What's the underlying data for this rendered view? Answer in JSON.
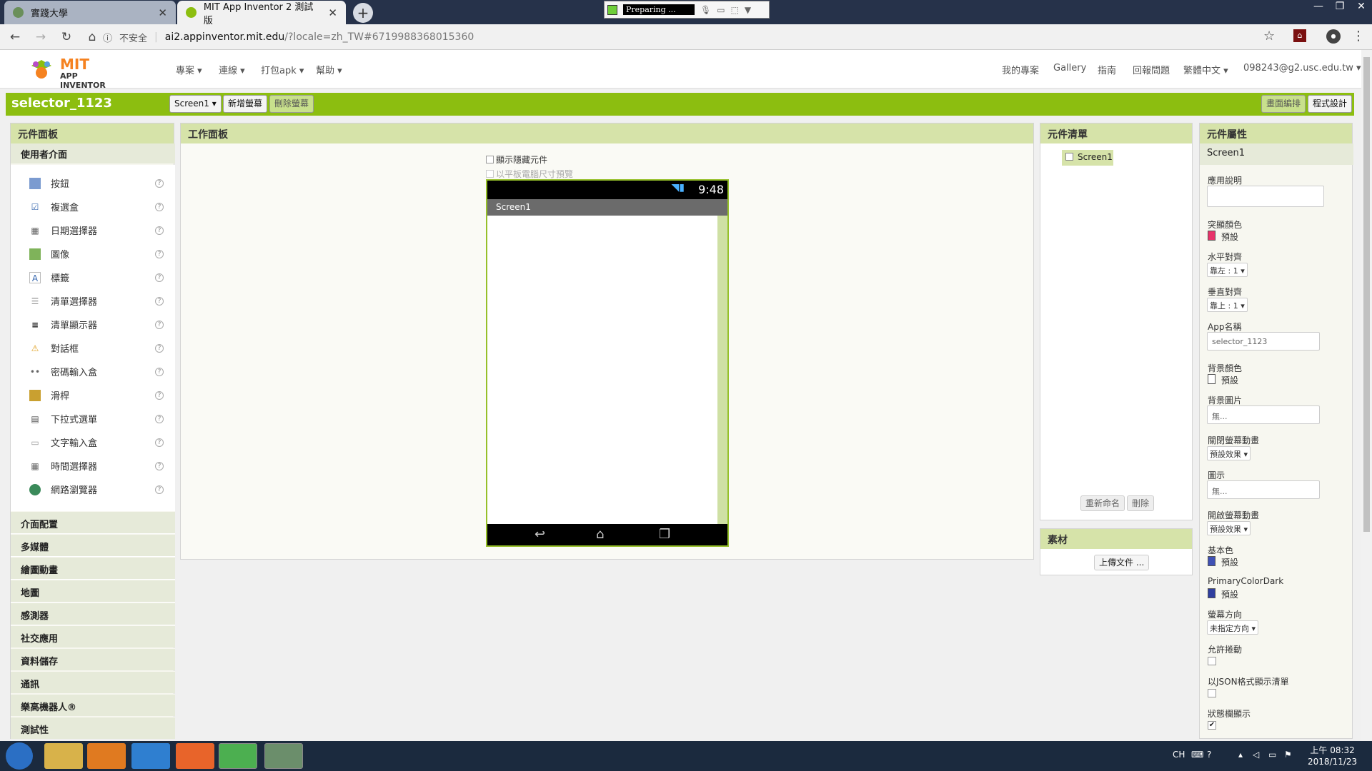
{
  "browser": {
    "tabs": [
      {
        "label": "實踐大學"
      },
      {
        "label": "MIT App Inventor 2 測試版"
      }
    ],
    "recorder": {
      "status": "Preparing ..."
    },
    "security_label": "不安全",
    "url_host": "ai2.appinventor.mit.edu",
    "url_path": "/?locale=zh_TW#6719988368015360"
  },
  "topnav": {
    "logo_mit": "MIT",
    "logo_sub": "APP INVENTOR",
    "menus": [
      "專案 ▾",
      "連線 ▾",
      "打包apk ▾",
      "幫助 ▾"
    ],
    "right_links": [
      "我的專案",
      "Gallery",
      "指南",
      "回報問題",
      "繁體中文 ▾",
      "098243@g2.usc.edu.tw ▾"
    ]
  },
  "project": {
    "name": "selector_1123",
    "screen_select": "Screen1 ▾",
    "add_screen": "新增螢幕",
    "remove_screen": "刪除螢幕",
    "designer": "畫面編排",
    "blocks": "程式設計"
  },
  "palette": {
    "title": "元件面板",
    "open_category": "使用者介面",
    "items": [
      {
        "label": "按鈕",
        "icon": "button-icon"
      },
      {
        "label": "複選盒",
        "icon": "checkbox-icon"
      },
      {
        "label": "日期選擇器",
        "icon": "datepicker-icon"
      },
      {
        "label": "圖像",
        "icon": "image-icon"
      },
      {
        "label": "標籤",
        "icon": "label-icon"
      },
      {
        "label": "清單選擇器",
        "icon": "listpicker-icon"
      },
      {
        "label": "清單顯示器",
        "icon": "listview-icon"
      },
      {
        "label": "對話框",
        "icon": "notifier-icon"
      },
      {
        "label": "密碼輸入盒",
        "icon": "password-icon"
      },
      {
        "label": "滑桿",
        "icon": "slider-icon"
      },
      {
        "label": "下拉式選單",
        "icon": "spinner-icon"
      },
      {
        "label": "文字輸入盒",
        "icon": "textbox-icon"
      },
      {
        "label": "時間選擇器",
        "icon": "timepicker-icon"
      },
      {
        "label": "網路瀏覽器",
        "icon": "webviewer-icon"
      }
    ],
    "categories": [
      "介面配置",
      "多媒體",
      "繪圖動畫",
      "地圖",
      "感測器",
      "社交應用",
      "資料儲存",
      "通訊",
      "樂高機器人®",
      "測試性"
    ]
  },
  "viewer": {
    "title": "工作面板",
    "show_hidden": "顯示隱藏元件",
    "tablet_preview": "以平板電腦尺寸預覽",
    "phone_time": "9:48",
    "screen_title": "Screen1"
  },
  "components": {
    "title": "元件清單",
    "root": "Screen1",
    "rename": "重新命名",
    "delete": "刪除"
  },
  "media": {
    "title": "素材",
    "upload": "上傳文件 ..."
  },
  "properties": {
    "title": "元件屬性",
    "selected": "Screen1",
    "about_label": "應用說明",
    "accent_label": "突顯顏色",
    "accent_value": "預設",
    "accent_color": "#e8336a",
    "align_h_label": "水平對齊",
    "align_h_value": "靠左 : 1 ▾",
    "align_v_label": "垂直對齊",
    "align_v_value": "靠上 : 1 ▾",
    "appname_label": "App名稱",
    "appname_value": "selector_1123",
    "bgcolor_label": "背景顏色",
    "bgcolor_value": "預設",
    "bgimage_label": "背景圖片",
    "bgimage_value": "無...",
    "close_anim_label": "關閉螢幕動畫",
    "close_anim_value": "預設效果 ▾",
    "icon_label": "圖示",
    "icon_value": "無...",
    "open_anim_label": "開啟螢幕動畫",
    "open_anim_value": "預設效果 ▾",
    "primary_label": "基本色",
    "primary_value": "預設",
    "primary_color": "#3f51b5",
    "primarydark_label": "PrimaryColorDark",
    "primarydark_value": "預設",
    "primarydark_color": "#303f9f",
    "orientation_label": "螢幕方向",
    "orientation_value": "未指定方向 ▾",
    "scroll_label": "允許捲動",
    "json_label": "以JSON格式顯示清單",
    "statusbar_label": "狀態欄顯示"
  },
  "taskbar": {
    "lang": "CH",
    "time": "上午 08:32",
    "date": "2018/11/23"
  }
}
